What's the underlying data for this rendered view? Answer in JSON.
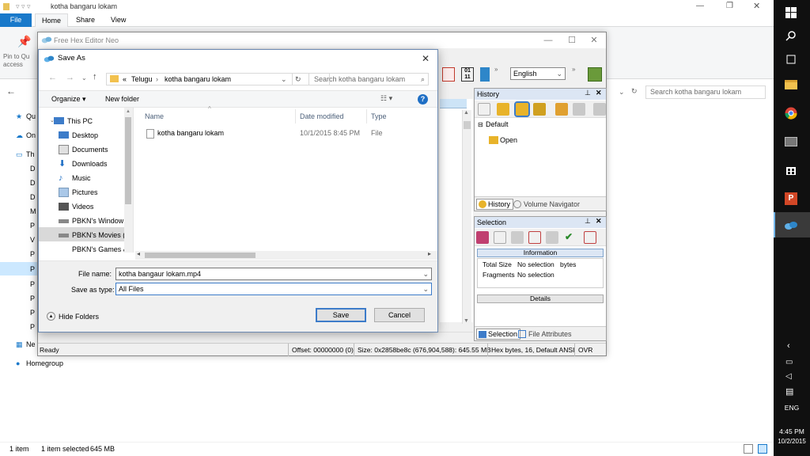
{
  "explorer": {
    "title": "kotha bangaru lokam",
    "ribbon_tabs": [
      "File",
      "Home",
      "Share",
      "View"
    ],
    "pin_label": "Pin to Qu access",
    "search_placeholder": "Search kotha bangaru lokam",
    "left_items": [
      "Qu",
      "On",
      "Th",
      "D",
      "D",
      "D",
      "M",
      "P",
      "V",
      "P",
      "P",
      "P",
      "P",
      "P",
      "P",
      "Ne",
      "Homegroup"
    ],
    "status": {
      "count": "1 item",
      "selected": "1 item selected",
      "size": "645 MB"
    }
  },
  "taskbar": {
    "time": "4:45 PM",
    "date": "10/2/2015",
    "lang": "ENG",
    "icons": [
      "windows-logo-icon",
      "search-icon",
      "task-view-icon",
      "file-explorer-icon",
      "chrome-icon",
      "media-player-icon",
      "store-icon",
      "powerpoint-icon",
      "hex-editor-icon"
    ]
  },
  "hex_editor": {
    "title": "Free Hex Editor Neo",
    "language_select": "English",
    "history_panel": {
      "title": "History",
      "default_node": "Default",
      "open_node": "Open",
      "tab_history": "History",
      "tab_volume": "Volume Navigator"
    },
    "selection_panel": {
      "title": "Selection",
      "information": "Information",
      "total_size_label": "Total Size",
      "total_size_value": "No selection",
      "total_size_unit": "bytes",
      "fragments_label": "Fragments",
      "fragments_value": "No selection",
      "details": "Details",
      "tab_selection": "Selection",
      "tab_file_attributes": "File Attributes"
    },
    "status": {
      "ready": "Ready",
      "offset": "Offset: 00000000 (0)",
      "size": "Size: 0x2858be8c (676,904,588): 645.55 MB",
      "mode": "Hex bytes, 16, Default ANSI",
      "ovr": "OVR"
    }
  },
  "dialog": {
    "title": "Save As",
    "breadcrumb": [
      "Telugu",
      "kotha bangaru lokam"
    ],
    "breadcrumb_prefix": "«",
    "search_placeholder": "Search kotha bangaru lokam",
    "organize": "Organize",
    "new_folder": "New folder",
    "tree": [
      "This PC",
      "Desktop",
      "Documents",
      "Downloads",
      "Music",
      "Pictures",
      "Videos",
      "PBKN's Window",
      "PBKN's Movies (",
      "PBKN's Games &"
    ],
    "columns": {
      "name": "Name",
      "date": "Date modified",
      "type": "Type"
    },
    "files": [
      {
        "name": "kotha bangaru lokam",
        "date": "10/1/2015 8:45 PM",
        "type": "File"
      }
    ],
    "file_name_label": "File name:",
    "file_name_value": "kotha bangaur lokam.mp4",
    "save_type_label": "Save as type:",
    "save_type_value": "All Files",
    "hide_folders": "Hide Folders",
    "save_button": "Save",
    "cancel_button": "Cancel"
  },
  "colors": {
    "accent": "#1979ca",
    "taskbar": "#101010",
    "selection_row": "#cce8ff"
  }
}
